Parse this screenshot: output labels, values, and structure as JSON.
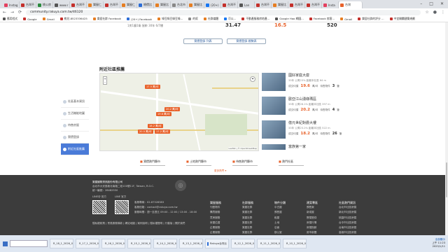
{
  "browser": {
    "tabs": [
      "Instag",
      "台灣不",
      "桃公房",
      "www.r",
      "台灣不",
      "樂屋仁",
      "台灣不",
      "樂屋仁",
      "總價比",
      "樂屋比",
      "台北市",
      "樂屋比",
      "(20+)",
      "台灣不",
      "Lan",
      "台灣不",
      "樂屋比",
      "台灣不",
      "台灣不",
      "Insta"
    ],
    "active_tab": "台灣",
    "url": "community.rakuya.com.tw/46120",
    "bookmarks": [
      "應用程式",
      "Google",
      "Gmail",
      "桃兒-8523336425",
      "樂居社群 Facebook",
      "(20+) Facebook",
      "綠豆綠豆綠豆綠...",
      "的幫",
      " 社群媒體",
      " 可以...",
      "不動產服務房地產...",
      "Google Hao 網圖...",
      "Facebook 房客...",
      "Gmail",
      "樂居社群的評分 ...",
      "中宜開闢建築規劃"
    ],
    "colors": {
      "accent": "#e8622b",
      "footer": "#3c3c3c",
      "active": "#4a7bd8"
    }
  },
  "top_section": {
    "meta": "1房1廳1衛  屋齡 30年 6/7樓",
    "p1": "31.47",
    "p2": "16.5",
    "p3": "520",
    "btn1": "實價登錄 列表",
    "btn2": "實價登錄 趨勢表"
  },
  "section_title": "附近社區推薦",
  "sidebar": [
    "社區基本資訊",
    "生活機能地圖",
    "待售房屋",
    "實價登錄",
    "附近社區推薦"
  ],
  "map": {
    "pins": [
      "17.5 萬/坪",
      "20.2 萬/坪",
      "19.6 萬/坪",
      "18.2 萬/坪",
      "20.5 萬/坪",
      "17.2 萬/坪"
    ],
    "credit": "Leaflet | © OpenStreetMap"
  },
  "listings": [
    {
      "title": "國好家庭大廈",
      "sub": "33年  公寓23%  距離本社區 64 m",
      "label": "成交均價",
      "price": "19.6",
      "unit": "萬/坪",
      "ct": "待售物件",
      "cnt": "3",
      "cu": "筆"
    },
    {
      "title": "歐亞江山湧綠瑪區",
      "sub": "33年  公寓28.1%  距離本社區 397 m",
      "label": "成交均價",
      "price": "20.2",
      "unit": "萬/坪",
      "ct": "待售物件",
      "cnt": "4",
      "cu": "筆"
    },
    {
      "title": "億元世紀對爵大樓",
      "sub": "33年  公寓23.2%  距離本社區 522 m",
      "label": "成交均價",
      "price": "18.2",
      "unit": "萬/坪",
      "ct": "待售物件",
      "cnt": "26",
      "cu": "筆"
    },
    {
      "title": "富族第一家",
      "sub": "",
      "label": "",
      "price": "",
      "unit": "",
      "ct": "",
      "cnt": "",
      "cu": ""
    }
  ],
  "bottom_links": [
    "實價熱門縣市",
    "土地熱門縣市",
    "待售熱門縣市",
    "熱門社區"
  ],
  "more": "更多熱門 ▾",
  "footer": {
    "company": "樂屋國際資訊股份有限公司",
    "addr": "台北市大安區敦化南路二段100號11F, Taiwan, R.O.C.",
    "tel": "統一編號：28482550",
    "qr1": "LINE@ 官方",
    "qr2": "LINE 官方",
    "service": "客服專線：02-87328383",
    "mail": "客服信箱：contact@rakuya.com.tw",
    "hours": "服務時間：週一至週五 09:00 - 12:00 / 13:00 - 18:00",
    "copyright": "隱私權政策 | 會員服務條款 | 網站地圖 | 案例說明 | 隱私權聲明 | 行動版 | 關於我們",
    "cols": [
      {
        "h": "樂屋服務",
        "items": [
          "刊登物件",
          "購買服務",
          "買房服務",
          "房屋估價",
          "企業服務",
          "企業服務",
          "企業服務",
          "手機版樂屋網",
          "免費刊登範例"
        ]
      },
      {
        "h": "社群服務",
        "items": [
          "樂屋社群",
          "樂屋社群",
          "樂屋社群",
          "樂屋社群",
          "樂屋社群",
          "樂屋社群",
          "樂屋社群",
          "樂屋社群"
        ]
      },
      {
        "h": "物件分類",
        "items": [
          "中古屋",
          "預售屋",
          "租屋",
          "土地",
          "店面",
          "辦公室",
          "廠房",
          "車位",
          "其他"
        ]
      },
      {
        "h": "建案專區",
        "items": [
          "預售案",
          "新成屋",
          "實價登錄",
          "房價行情",
          "房價指數",
          "房市新聞",
          "買賣指南",
          "社區大樓",
          "更多"
        ]
      },
      {
        "h": "社區熱門資訊",
        "items": [
          "台北市社區房價",
          "新北市社區房價",
          "桃園市社區房價",
          "台中市社區房價",
          "台南市社區房價",
          "高雄市社區房價",
          "新竹縣社區房價",
          "基隆市社區房價",
          "更多社區"
        ]
      }
    ]
  },
  "taskbar": {
    "items": [
      "R_18_1_2026_04...jpg",
      "R_17_1_2026_04...jpg",
      "R_16_1_2026_04...jpg",
      "R_15_1_2026_04...jpg",
      "R_14_1_2026_04...jpg",
      "R_13_1_2026_04...jpg",
      "Rakuya台灣比",
      "R_12_1_2026_04...jpg",
      "R_11_1_2026_04...jpg",
      "R_10_1_2026_04...jpg"
    ],
    "show_all": "全部顯示",
    "time": "上午 11:23",
    "date": "2023/1/11"
  }
}
